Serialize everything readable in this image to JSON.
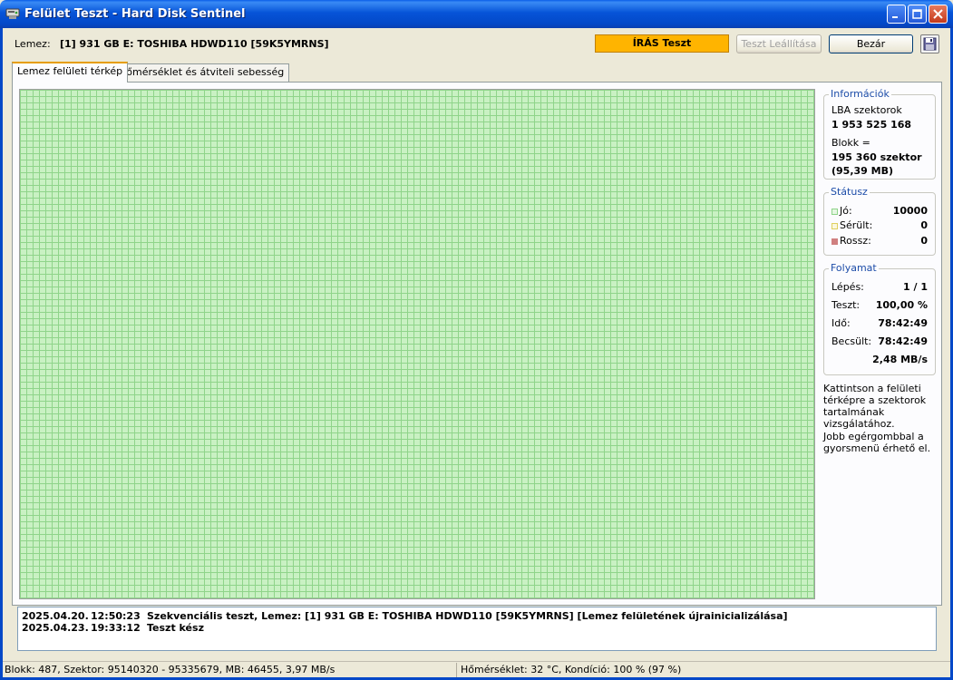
{
  "window": {
    "title": "Felület Teszt - Hard Disk Sentinel"
  },
  "header": {
    "disk_label": "Lemez:",
    "disk_value": "[1] 931 GB E: TOSHIBA HDWD110 [59K5YMRNS]",
    "write_test_label": "ÍRÁS Teszt",
    "stop_test_label": "Teszt Leállítása",
    "close_label": "Bezár"
  },
  "tabs": [
    {
      "label": "Lemez felületi térkép"
    },
    {
      "label": "Hőmérséklet és átviteli sebesség"
    }
  ],
  "info": {
    "title": "Információk",
    "lba_label": "LBA szektorok",
    "lba_value": "1 953 525 168",
    "block_label": "Blokk =",
    "block_value": "195 360 szektor",
    "block_size": "(95,39 MB)"
  },
  "status": {
    "title": "Státusz",
    "good_label": "Jó:",
    "good_value": "10000",
    "damaged_label": "Sérült:",
    "damaged_value": "0",
    "bad_label": "Rossz:",
    "bad_value": "0",
    "colors": {
      "good": "#8fd48a",
      "damaged": "#e0d060",
      "bad": "#d08080"
    }
  },
  "progress": {
    "title": "Folyamat",
    "step_label": "Lépés:",
    "step_value": "1 / 1",
    "test_label": "Teszt:",
    "test_value": "100,00 %",
    "time_label": "Idő:",
    "time_value": "78:42:49",
    "estimated_label": "Becsült:",
    "estimated_value": "78:42:49",
    "speed_value": "2,48 MB/s"
  },
  "hints": {
    "click_hint": "Kattintson a felületi térképre a szektorok tartalmának vizsgálatához.",
    "right_click_hint": "Jobb egérgombbal a gyorsmenü érhető el."
  },
  "log": [
    {
      "date": "2025.04.20.",
      "time": "12:50:23",
      "message": "Szekvenciális teszt, Lemez: [1] 931 GB E: TOSHIBA HDWD110 [59K5YMRNS] [Lemez felületének újrainicializálása]"
    },
    {
      "date": "2025.04.23.",
      "time": "19:33:12",
      "message": "Teszt kész"
    }
  ],
  "statusbar": {
    "left": "Blokk: 487, Szektor: 95140320 - 95335679, MB: 46455, 3,97 MB/s",
    "right": "Hőmérséklet: 32  °C,  Kondíció: 100 % (97 %)"
  },
  "colors": {
    "write_test_bg": "#ffb400",
    "map_fill": "#c9f1c3",
    "map_grid": "#8fd48a"
  }
}
